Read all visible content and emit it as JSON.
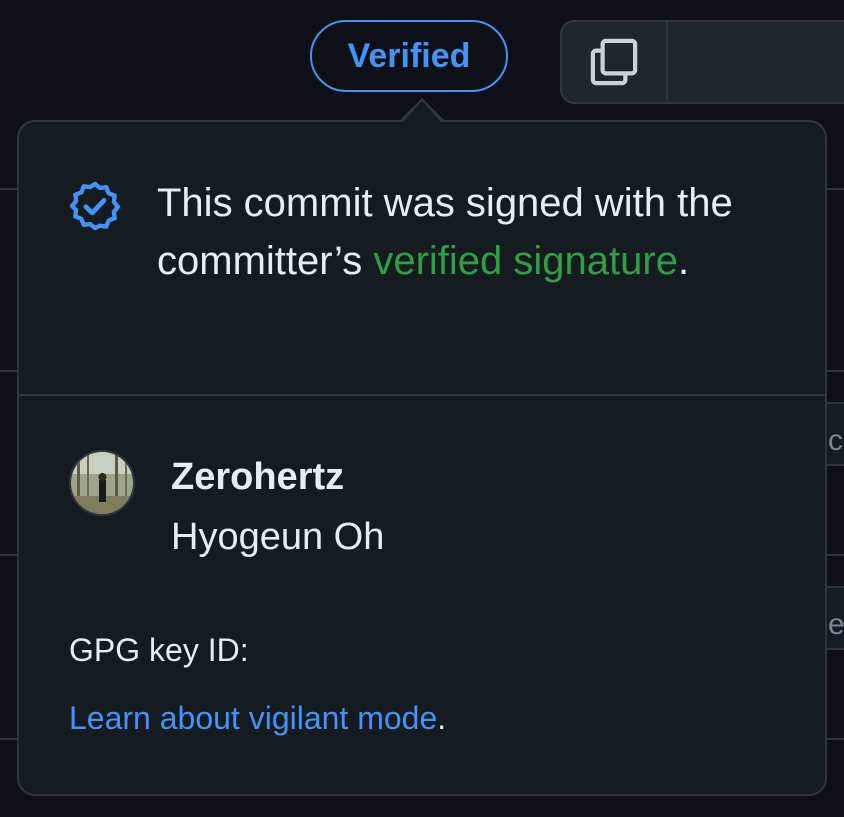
{
  "badge": {
    "label": "Verified",
    "accent_color": "#4493f8"
  },
  "toolbar": {
    "copy_icon": "copy-icon"
  },
  "popover": {
    "status_icon": "verified-check-icon",
    "message_prefix": "This commit was signed with the committer’s ",
    "message_link": "verified signature",
    "message_suffix": ".",
    "link_color": "#2ea043",
    "user": {
      "username": "Zerohertz",
      "full_name": "Hyogeun Oh",
      "avatar": "avatar-photo"
    },
    "gpg_label": "GPG key ID:",
    "gpg_value": "",
    "learn_link": "Learn about vigilant mode",
    "learn_suffix": ".",
    "learn_link_color": "#4493f8"
  },
  "background": {
    "edge_chars": [
      "c",
      "e"
    ]
  }
}
